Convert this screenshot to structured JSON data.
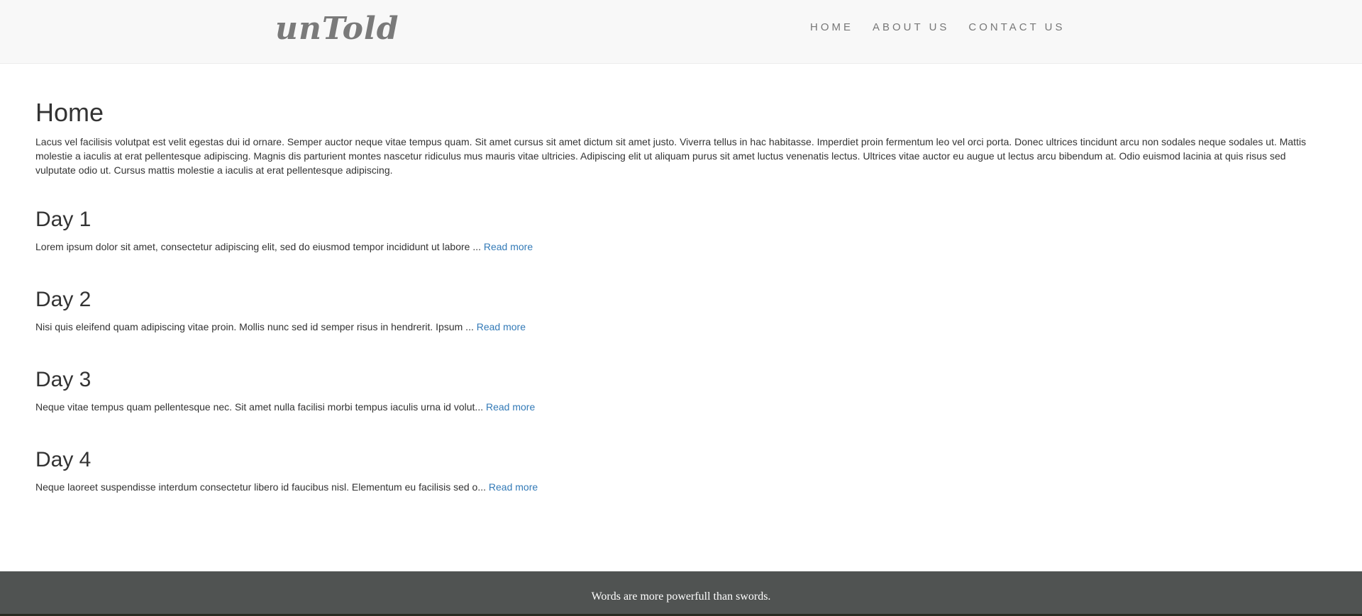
{
  "brand": "unTold",
  "nav": {
    "items": [
      "HOME",
      "ABOUT US",
      "CONTACT US"
    ]
  },
  "page": {
    "title": "Home",
    "intro": "Lacus vel facilisis volutpat est velit egestas dui id ornare. Semper auctor neque vitae tempus quam. Sit amet cursus sit amet dictum sit amet justo. Viverra tellus in hac habitasse. Imperdiet proin fermentum leo vel orci porta. Donec ultrices tincidunt arcu non sodales neque sodales ut. Mattis molestie a iaculis at erat pellentesque adipiscing. Magnis dis parturient montes nascetur ridiculus mus mauris vitae ultricies. Adipiscing elit ut aliquam purus sit amet luctus venenatis lectus. Ultrices vitae auctor eu augue ut lectus arcu bibendum at. Odio euismod lacinia at quis risus sed vulputate odio ut. Cursus mattis molestie a iaculis at erat pellentesque adipiscing."
  },
  "posts": [
    {
      "title": "Day 1",
      "excerpt": "Lorem ipsum dolor sit amet, consectetur adipiscing elit, sed do eiusmod tempor incididunt ut labore ... ",
      "link": "Read more"
    },
    {
      "title": "Day 2",
      "excerpt": "Nisi quis eleifend quam adipiscing vitae proin. Mollis nunc sed id semper risus in hendrerit. Ipsum ... ",
      "link": "Read more"
    },
    {
      "title": "Day 3",
      "excerpt": "Neque vitae tempus quam pellentesque nec. Sit amet nulla facilisi morbi tempus iaculis urna id volut... ",
      "link": "Read more"
    },
    {
      "title": "Day 4",
      "excerpt": "Neque laoreet suspendisse interdum consectetur libero id faucibus nisl. Elementum eu facilisis sed o... ",
      "link": "Read more"
    }
  ],
  "footer": {
    "text": "Words are more powerfull than swords."
  },
  "colors": {
    "navbar_bg": "#f8f8f8",
    "link": "#337ab7",
    "footer_bg": "#505352",
    "text": "#333333"
  }
}
